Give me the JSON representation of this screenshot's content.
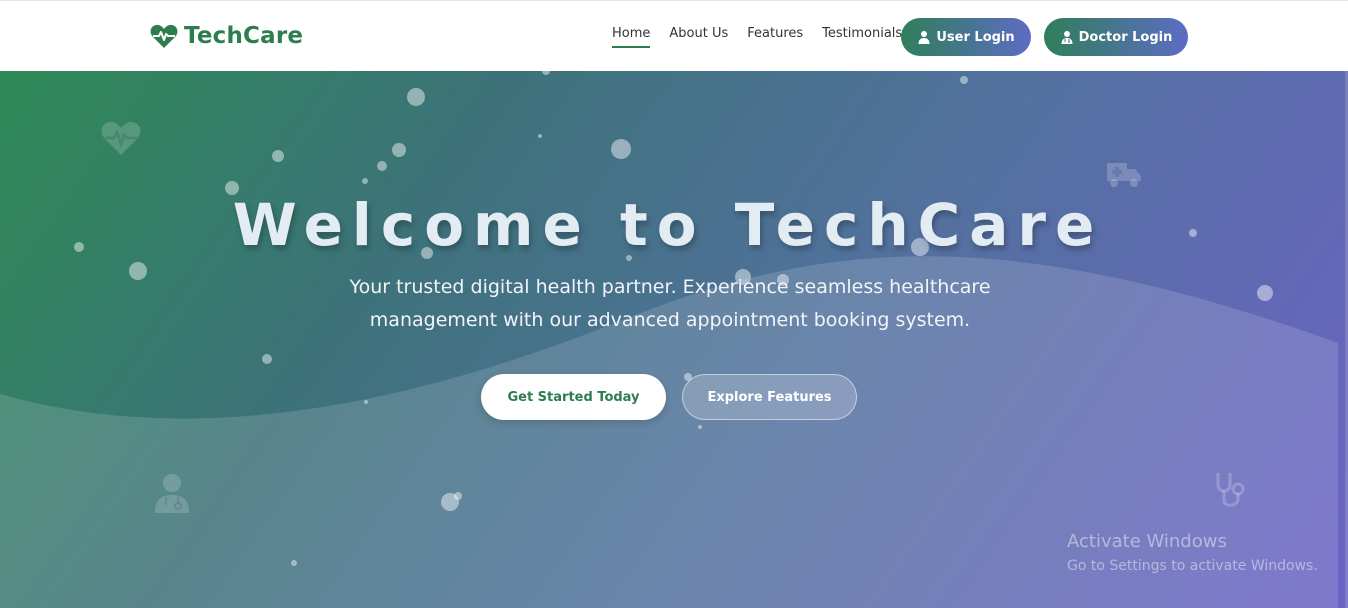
{
  "brand": {
    "name": "TechCare",
    "icon": "heart-pulse-icon",
    "color": "#2e7d4f"
  },
  "nav": {
    "links": [
      {
        "label": "Home",
        "active": true
      },
      {
        "label": "About Us",
        "active": false
      },
      {
        "label": "Features",
        "active": false
      },
      {
        "label": "Testimonials",
        "active": false
      }
    ],
    "user_login": "User Login",
    "doctor_login": "Doctor Login"
  },
  "hero": {
    "title": "Welcome to TechCare",
    "subtitle": "Your trusted digital health partner. Experience seamless healthcare management with our advanced appointment booking system.",
    "primary_cta": "Get Started Today",
    "secondary_cta": "Explore Features",
    "decor_icons": [
      "heart-pulse-icon",
      "ambulance-icon",
      "doctor-icon",
      "stethoscope-icon"
    ]
  },
  "watermark": {
    "title": "Activate Windows",
    "subtitle": "Go to Settings to activate Windows."
  },
  "colors": {
    "accent_green": "#2e7d4f",
    "accent_purple": "#6c63c6",
    "white": "#ffffff"
  }
}
